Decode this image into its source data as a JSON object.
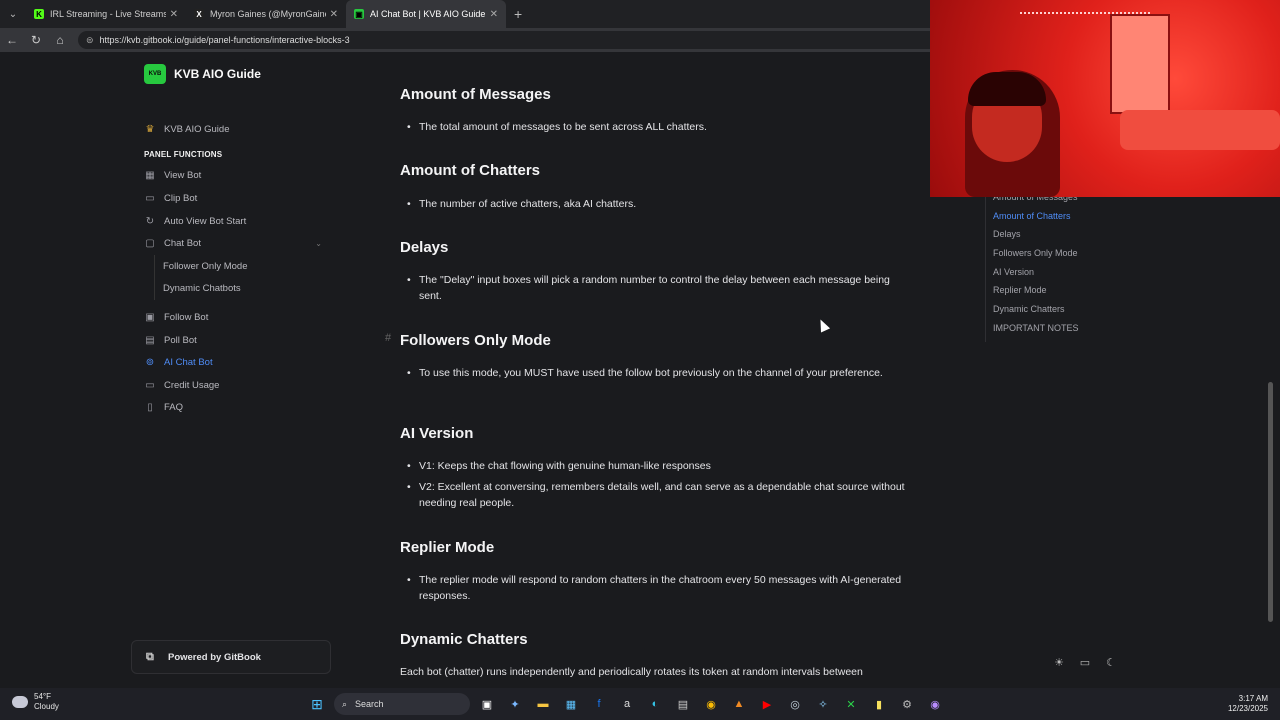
{
  "browser": {
    "tabs": [
      {
        "title": "IRL Streaming - Live Streams on Ki",
        "color": "#53fc18",
        "glyph": "K"
      },
      {
        "title": "Myron Gaines (@MyronGainesX) / X",
        "color": "#222222",
        "glyph": "X"
      },
      {
        "title": "AI Chat Bot | KVB AIO Guide",
        "color": "#27c93f",
        "glyph": "▣"
      }
    ],
    "url": "https://kvb.gitbook.io/guide/panel-functions/interactive-blocks-3"
  },
  "brand": {
    "logo_text": "KVB",
    "name": "KVB AIO Guide"
  },
  "sidebar": {
    "top_item": "KVB AIO Guide",
    "heading": "PANEL FUNCTIONS",
    "items": [
      {
        "label": "View Bot",
        "icon": "table-icon",
        "glyph": "▦"
      },
      {
        "label": "Clip Bot",
        "icon": "film-icon",
        "glyph": "▭"
      },
      {
        "label": "Auto View Bot Start",
        "icon": "refresh-icon",
        "glyph": "↻"
      },
      {
        "label": "Chat Bot",
        "icon": "chat-icon",
        "glyph": "▢"
      }
    ],
    "sub_items": [
      "Follower Only Mode",
      "Dynamic Chatbots"
    ],
    "items_after": [
      {
        "label": "Follow Bot",
        "icon": "folder-icon",
        "glyph": "▣"
      },
      {
        "label": "Poll Bot",
        "icon": "poll-icon",
        "glyph": "▤"
      },
      {
        "label": "AI Chat Bot",
        "icon": "link-icon",
        "glyph": "⊚",
        "active": true
      },
      {
        "label": "Credit Usage",
        "icon": "card-icon",
        "glyph": "▭"
      },
      {
        "label": "FAQ",
        "icon": "doc-icon",
        "glyph": "▯"
      }
    ],
    "powered": "Powered by GitBook"
  },
  "content": {
    "sections": [
      {
        "heading": "Amount of Messages",
        "bullets": [
          "The total amount of messages to be sent across ALL chatters."
        ]
      },
      {
        "heading": "Amount of Chatters",
        "bullets": [
          "The number of active chatters, aka AI chatters."
        ]
      },
      {
        "heading": "Delays",
        "bullets": [
          "The \"Delay\" input boxes will pick a random number to control the delay between each message being sent."
        ]
      },
      {
        "heading": "Followers Only Mode",
        "bullets": [
          "To use this mode, you MUST have used the follow bot previously on the channel of your preference."
        ]
      },
      {
        "heading": "AI Version",
        "bullets": [
          "V1: Keeps the chat flowing with genuine human-like responses",
          "V2: Excellent at conversing, remembers details well, and can serve as a dependable chat source without needing real people."
        ]
      },
      {
        "heading": "Replier Mode",
        "bullets": [
          "The replier mode will respond to random chatters in the chatroom every 50 messages with AI-generated responses."
        ]
      },
      {
        "heading": "Dynamic Chatters",
        "body": "Each bot (chatter) runs independently and periodically rotates its token at random intervals between"
      }
    ],
    "anchor_symbol": "#"
  },
  "toc": {
    "items": [
      "Amount of Messages",
      "Amount of Chatters",
      "Delays",
      "Followers Only Mode",
      "AI Version",
      "Replier Mode",
      "Dynamic Chatters",
      "IMPORTANT NOTES"
    ],
    "active_index": 1
  },
  "taskbar": {
    "temperature": "54°F",
    "condition": "Cloudy",
    "search_label": "Search",
    "time": "3:17 AM",
    "date": "12/23/2025"
  }
}
